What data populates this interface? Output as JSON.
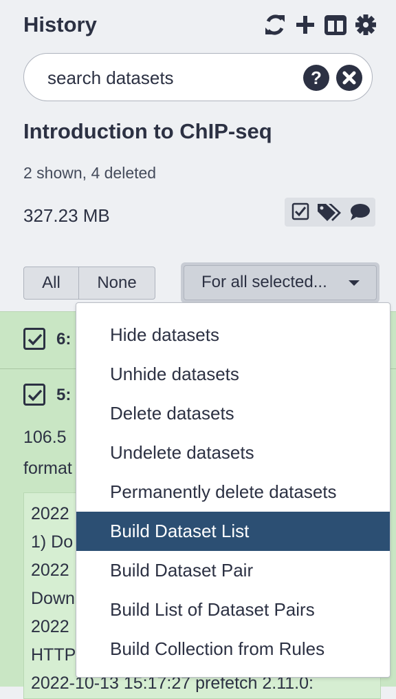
{
  "header": {
    "title": "History",
    "icons": [
      "sync-icon",
      "plus-icon",
      "columns-icon",
      "gear-icon"
    ]
  },
  "search": {
    "placeholder": "search datasets"
  },
  "history": {
    "name": "Introduction to ChIP-seq",
    "counts": "2 shown, 4 deleted",
    "size": "327.23 MB"
  },
  "selection": {
    "all_label": "All",
    "none_label": "None",
    "for_all_label": "For all selected..."
  },
  "items": [
    {
      "hid": "6:"
    },
    {
      "hid": "5:",
      "size_partial": "106.5",
      "format_partial": "format"
    }
  ],
  "log_lines": [
    "2022",
    "1) Do",
    "2022",
    "Down",
    "2022",
    "HTTP",
    "2022-10-13 15:17:27 prefetch 2.11.0:"
  ],
  "menu": {
    "items": [
      "Hide datasets",
      "Unhide datasets",
      "Delete datasets",
      "Undelete datasets",
      "Permanently delete datasets",
      "Build Dataset List",
      "Build Dataset Pair",
      "Build List of Dataset Pairs",
      "Build Collection from Rules"
    ],
    "active_index": 5
  },
  "colors": {
    "menu_active": "#2c4f73",
    "selected_item_bg": "#c9e6c4",
    "text": "#2c3143"
  }
}
